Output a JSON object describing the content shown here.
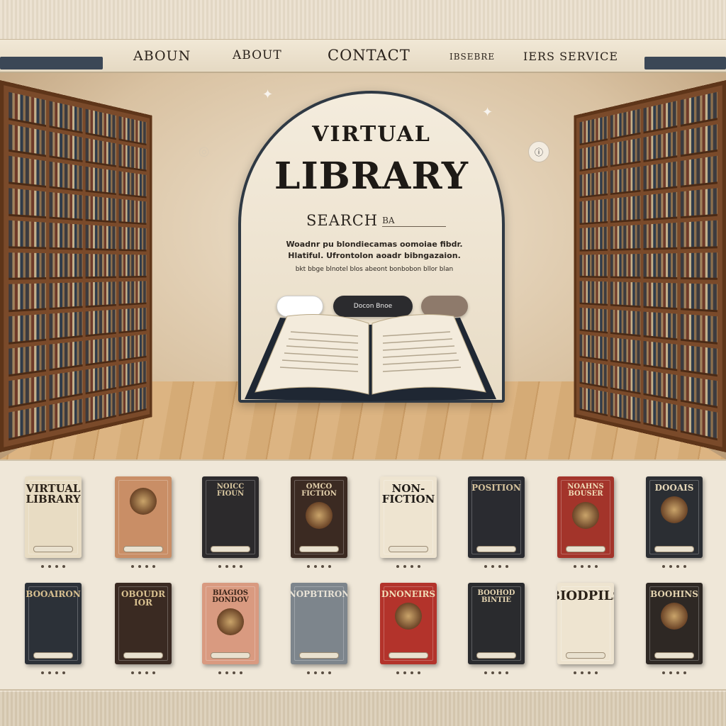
{
  "nav": {
    "items": [
      "ABOUN",
      "ABOUT",
      "CONTACT",
      "IBSEBRE",
      "IERS SERVICE"
    ]
  },
  "hero": {
    "title_line1": "VIRTUAL",
    "title_line2": "LIBRARY",
    "search": {
      "label": "SEARCH",
      "value": "BA"
    },
    "description": {
      "line1": "Woadnr pu blondiecamas oomoiae fibdr.",
      "line2": "Hlatiful. Ufrontolon aoadr bibngazaion.",
      "line3": "bkt bbge blnotel blos    abeont bonbobon bllor blan"
    },
    "buttons": [
      "",
      "Docon Bnoe",
      ""
    ]
  },
  "catalog": {
    "row1": [
      {
        "title": "VIRTUAL\nLIBRARY",
        "bg": "#e8dcc3",
        "fg": "#2a2118",
        "style": "light"
      },
      {
        "title": "",
        "bg": "#c98e66",
        "fg": "#3b2416",
        "style": "emblem"
      },
      {
        "title": "NOICC\nFIOUN",
        "bg": "#2c2a2c",
        "fg": "#d9c7a0",
        "style": "dark"
      },
      {
        "title": "OMCO\nFICTION",
        "bg": "#3b2a22",
        "fg": "#e6d3ae",
        "style": "emblem"
      },
      {
        "title": "NON-\nFICTION",
        "bg": "#eee4d0",
        "fg": "#1e1a16",
        "style": "light"
      },
      {
        "title": "POSITION",
        "bg": "#2a2b30",
        "fg": "#d5c29c",
        "style": "dark"
      },
      {
        "title": "NOAHNS\nBOUSER",
        "bg": "#a3342a",
        "fg": "#f0dcb7",
        "style": "emblem"
      },
      {
        "title": "DOOAIS",
        "bg": "#2b2e33",
        "fg": "#e5d7b8",
        "style": "emblem"
      }
    ],
    "row2": [
      {
        "title": "BOOAIRON",
        "bg": "#2c3138",
        "fg": "#d8c090",
        "style": "dark"
      },
      {
        "title": "OBOUDR\nIOR",
        "bg": "#3a2a22",
        "fg": "#d8c090",
        "style": "dark"
      },
      {
        "title": "BIAGIOS\nDONDOV",
        "bg": "#d99a80",
        "fg": "#3a2418",
        "style": "emblem"
      },
      {
        "title": "NOPBTIRON",
        "bg": "#7d858c",
        "fg": "#e8e2d6",
        "style": "dark"
      },
      {
        "title": "DNONEIRS",
        "bg": "#b3332b",
        "fg": "#f0dcb7",
        "style": "emblem"
      },
      {
        "title": "BOOHOD\nBINTIE",
        "bg": "#2a2b2e",
        "fg": "#e3d3b0",
        "style": "dark"
      },
      {
        "title": "BIODPILS",
        "bg": "#eee4d0",
        "fg": "#2a2118",
        "style": "light"
      },
      {
        "title": "BOOHINS",
        "bg": "#2e2824",
        "fg": "#e3d3b0",
        "style": "emblem"
      }
    ]
  },
  "colors": {
    "nav_rail": "#3b4756",
    "arch_border": "#2f3944",
    "shelf_wood": "#7a4a2a",
    "page_bg": "#efe7d8"
  },
  "icons": [
    "search-icon",
    "info-icon",
    "sparkle-icon",
    "open-book-icon"
  ]
}
